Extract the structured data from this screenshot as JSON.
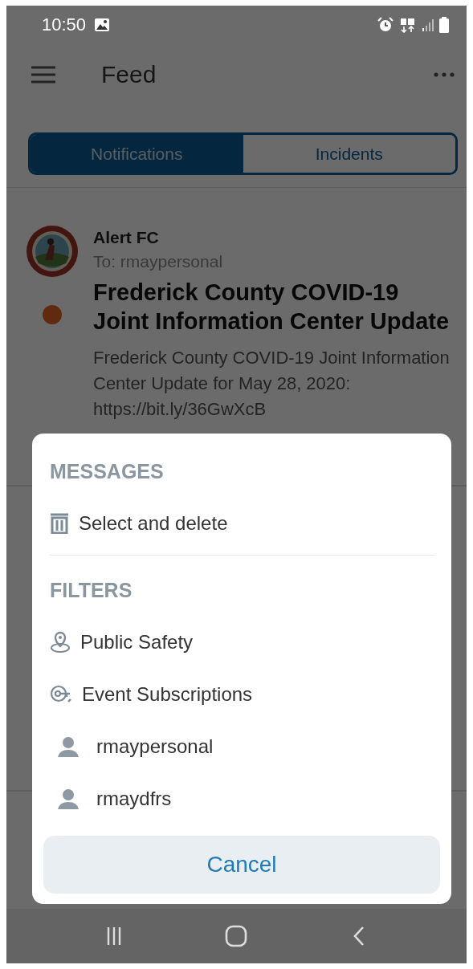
{
  "status_bar": {
    "time": "10:50"
  },
  "app_bar": {
    "title": "Feed"
  },
  "tabs": [
    {
      "label": "Notifications",
      "selected": true
    },
    {
      "label": "Incidents",
      "selected": false
    }
  ],
  "feed": [
    {
      "sender": "Alert FC",
      "recipient": "To: rmaypersonal",
      "unread": true,
      "title": "Frederick County COVID-19 Joint Information Center Update",
      "body": "Frederick County COVID-19 Joint Information Center Update for May 28, 2020: https://bit.ly/36GwXcB"
    }
  ],
  "sheet": {
    "sections": [
      {
        "title": "MESSAGES",
        "items": [
          {
            "kind": "trash",
            "label": "Select and delete"
          }
        ]
      },
      {
        "title": "FILTERS",
        "items": [
          {
            "kind": "location",
            "label": "Public Safety"
          },
          {
            "kind": "key",
            "label": "Event Subscriptions"
          },
          {
            "kind": "person",
            "label": "rmaypersonal"
          },
          {
            "kind": "person",
            "label": "rmaydfrs"
          }
        ]
      }
    ],
    "cancel": "Cancel"
  }
}
